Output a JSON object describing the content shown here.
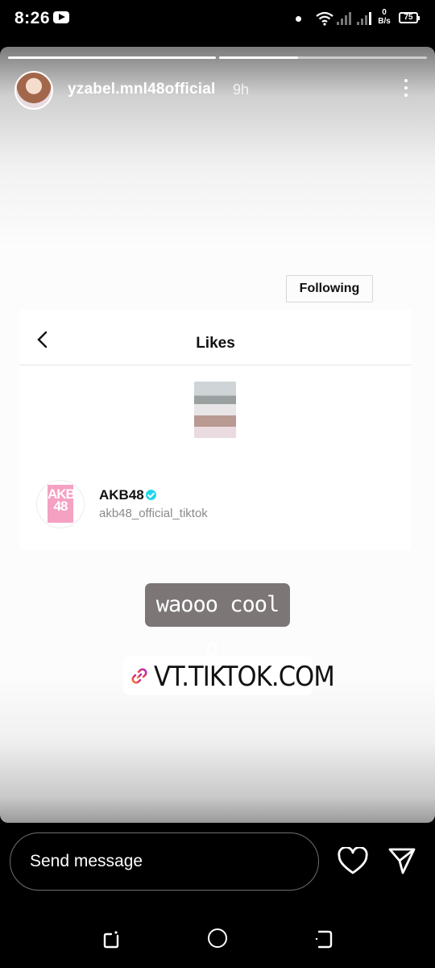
{
  "status_bar": {
    "time": "8:26",
    "net_speed_value": "0",
    "net_speed_unit": "B/s",
    "battery": "75",
    "icons": [
      "youtube-icon",
      "notification-dot-icon",
      "wifi-icon",
      "signal-icon",
      "signal-icon",
      "battery-icon"
    ]
  },
  "story": {
    "username": "yzabel.mnl48official",
    "time_ago": "9h",
    "progress": [
      1.0,
      0.38
    ],
    "card": {
      "title": "Likes",
      "account_name": "AKB48",
      "account_handle": "akb48_official_tiktok",
      "follow_button": "Following",
      "logo_text": "AKB\n48"
    },
    "caption": "waooo cool o:",
    "link_sticker": "VT.TIKTOK.COM"
  },
  "bottom_bar": {
    "message_placeholder": "Send message"
  },
  "colors": {
    "verified": "#20d5ec",
    "logo_pink": "#f4a1c2",
    "caption_bg": "#7c7677"
  }
}
